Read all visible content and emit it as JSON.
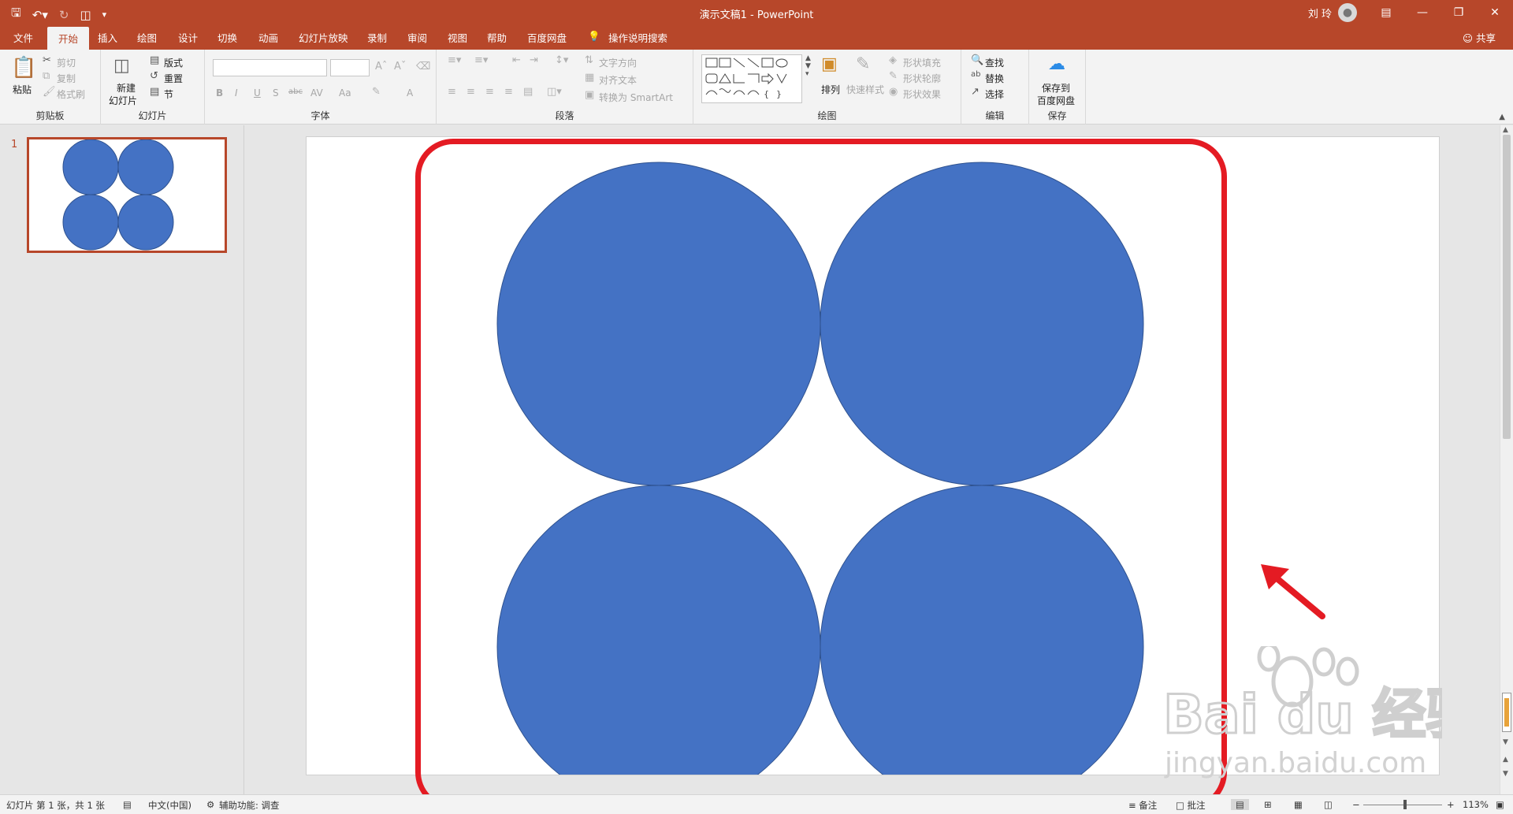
{
  "window": {
    "title": "演示文稿1 - PowerPoint",
    "user": "刘 玲",
    "qat": [
      "save-icon",
      "undo-icon",
      "redo-icon",
      "present-icon",
      "customize-icon"
    ]
  },
  "tabs": [
    "文件",
    "开始",
    "插入",
    "绘图",
    "设计",
    "切换",
    "动画",
    "幻灯片放映",
    "录制",
    "审阅",
    "视图",
    "帮助",
    "百度网盘"
  ],
  "active_tab": "开始",
  "tell_me": "操作说明搜索",
  "share": "共享",
  "ribbon": {
    "clipboard": {
      "label": "剪贴板",
      "paste": "粘贴",
      "cut": "剪切",
      "copy": "复制",
      "format_painter": "格式刷"
    },
    "slides": {
      "label": "幻灯片",
      "new_slide_line1": "新建",
      "new_slide_line2": "幻灯片",
      "layout": "版式",
      "reset": "重置",
      "section": "节"
    },
    "font": {
      "label": "字体",
      "font_name": "",
      "font_size": "",
      "bold": "B",
      "italic": "I",
      "underline": "U",
      "shadow": "S",
      "strike": "abc",
      "spacing": "AV",
      "case": "Aa",
      "color": "A"
    },
    "paragraph": {
      "label": "段落",
      "text_direction": "文字方向",
      "align_text": "对齐文本",
      "smartart": "转换为 SmartArt"
    },
    "drawing": {
      "label": "绘图",
      "arrange": "排列",
      "quick_styles": "快速样式",
      "shape_fill": "形状填充",
      "shape_outline": "形状轮廓",
      "shape_effects": "形状效果"
    },
    "editing": {
      "label": "编辑",
      "find": "查找",
      "replace": "替换",
      "select": "选择"
    },
    "save": {
      "label": "保存",
      "btn_line1": "保存到",
      "btn_line2": "百度网盘"
    }
  },
  "thumbnails": [
    {
      "number": "1"
    }
  ],
  "slide": {
    "shape_fill": "#4472c4",
    "shape_stroke": "#2f528f",
    "shapes": [
      "circle",
      "circle",
      "circle",
      "circle"
    ]
  },
  "status": {
    "slide_info": "幻灯片 第 1 张，共 1 张",
    "language": "中文(中国)",
    "accessibility": "辅助功能: 调查",
    "notes": "备注",
    "comments": "批注",
    "zoom": "113%"
  },
  "watermark": {
    "brand": "Bai du 经验",
    "url": "jingyan.baidu.com"
  },
  "annotation_color": "#e41b23",
  "accent": "#b7472a"
}
